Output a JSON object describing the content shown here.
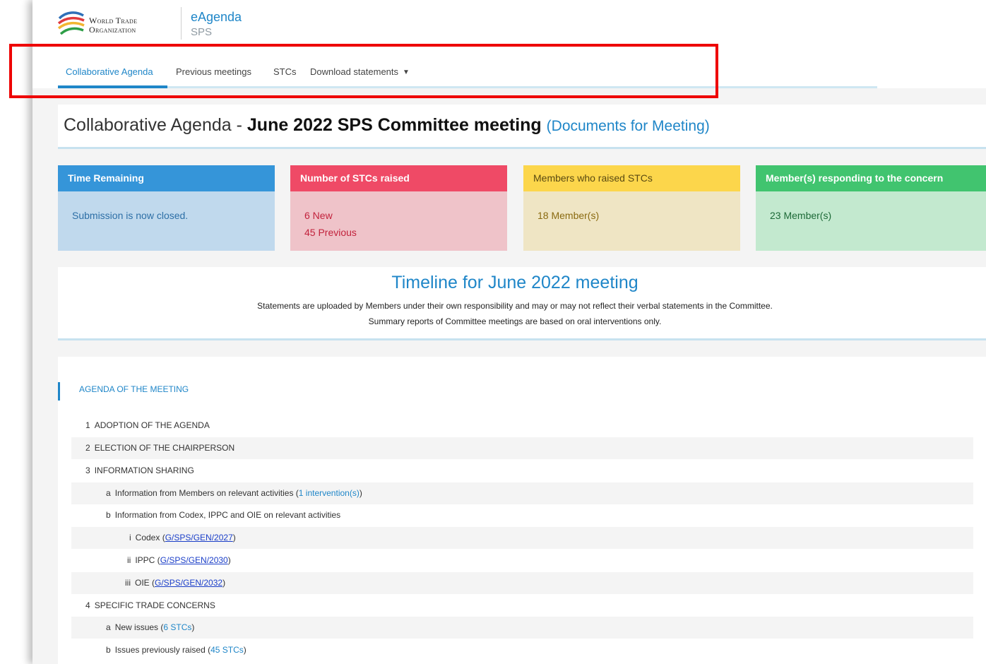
{
  "header": {
    "logo_line1": "World Trade",
    "logo_line2": "Organization",
    "app_title": "eAgenda",
    "app_subtitle": "SPS"
  },
  "nav": {
    "tabs": [
      {
        "label": "Collaborative Agenda",
        "active": true
      },
      {
        "label": "Previous meetings"
      },
      {
        "label": "STCs"
      },
      {
        "label": "Download statements"
      }
    ]
  },
  "page": {
    "title_prefix": "Collaborative Agenda - ",
    "title_bold": "June 2022 SPS Committee meeting",
    "title_link": "Documents for Meeting"
  },
  "cards": [
    {
      "header": "Time Remaining",
      "lines": [
        "Submission is now closed."
      ],
      "color": "#3595d9"
    },
    {
      "header": "Number of STCs raised",
      "lines": [
        "6 New",
        "45 Previous"
      ],
      "color": "#ef4a66"
    },
    {
      "header": "Members who raised STCs",
      "lines": [
        "18 Member(s)"
      ],
      "color": "#fcd64b"
    },
    {
      "header": "Member(s) responding to the concern",
      "lines": [
        "23 Member(s)"
      ],
      "color": "#41c46f"
    }
  ],
  "timeline": {
    "title": "Timeline for June 2022 meeting",
    "note1": "Statements are uploaded by Members under their own responsibility and may or may not reflect their verbal statements in the Committee.",
    "note2": "Summary reports of Committee meetings are based on oral interventions only."
  },
  "agenda": {
    "title": "AGENDA OF THE MEETING",
    "items": [
      {
        "num": "1",
        "text": "ADOPTION OF THE AGENDA"
      },
      {
        "num": "2",
        "text": "ELECTION OF THE CHAIRPERSON"
      },
      {
        "num": "3",
        "text": "INFORMATION SHARING"
      },
      {
        "num": "a",
        "text": "Information from Members on relevant activities (",
        "link": "1 intervention(s)",
        "after": ")"
      },
      {
        "num": "b",
        "text": "Information from Codex, IPPC and OIE on relevant activities"
      },
      {
        "num": "i",
        "text": "Codex (",
        "link": "G/SPS/GEN/2027",
        "after": ")"
      },
      {
        "num": "ii",
        "text": "IPPC (",
        "link": "G/SPS/GEN/2030",
        "after": ")"
      },
      {
        "num": "iii",
        "text": "OIE (",
        "link": "G/SPS/GEN/2032",
        "after": ")"
      },
      {
        "num": "4",
        "text": "SPECIFIC TRADE CONCERNS"
      },
      {
        "num": "a",
        "text": "New issues (",
        "link": "6 STCs",
        "after": ")"
      },
      {
        "num": "b",
        "text": "Issues previously raised (",
        "link": "45 STCs",
        "after": ")"
      }
    ]
  }
}
